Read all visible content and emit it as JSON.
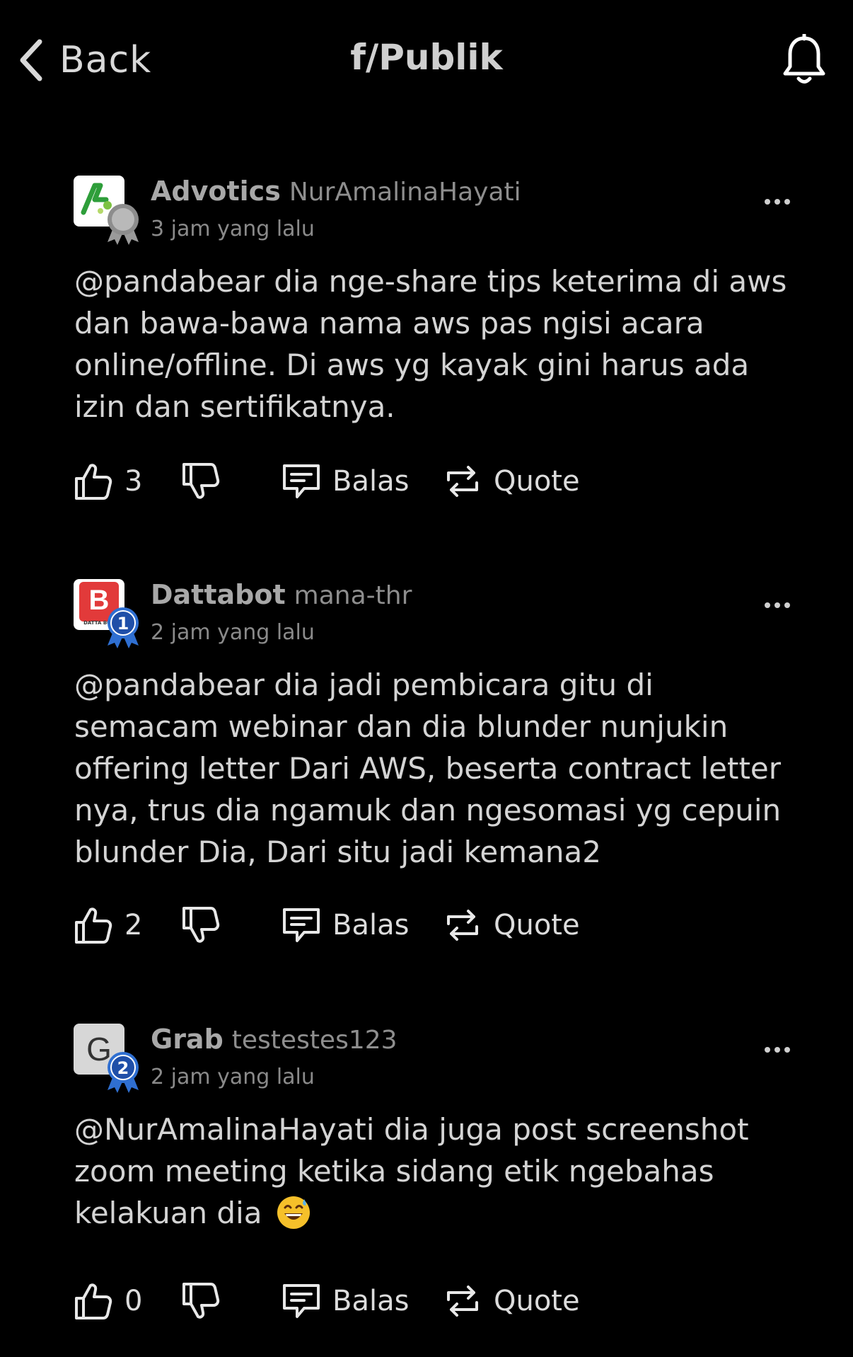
{
  "header": {
    "back_label": "Back",
    "title": "f/Publik"
  },
  "posts": [
    {
      "author": "Advotics",
      "handle": "NurAmalinaHayati",
      "time": "3 jam yang lalu",
      "badge": "silver-medal",
      "text": "@pandabear dia nge-share tips keterima di aws dan bawa-bawa nama aws pas ngisi acara online/offline. Di aws yg kayak gini harus ada izin dan sertifikatnya.",
      "likes": "3",
      "reply_label": "Balas",
      "quote_label": "Quote"
    },
    {
      "author": "Dattabot",
      "handle": "mana-thr",
      "time": "2 jam yang lalu",
      "badge_rank": "1",
      "avatar_letter": "B",
      "avatar_caption": "DATTA BOT",
      "text": "@pandabear dia jadi pembicara gitu di semacam webinar dan dia blunder nunjukin offering letter Dari AWS, beserta contract letter nya, trus dia ngamuk dan ngesomasi yg cepuin blunder Dia, Dari situ jadi kemana2",
      "likes": "2",
      "reply_label": "Balas",
      "quote_label": "Quote"
    },
    {
      "author": "Grab",
      "handle": "testestes123",
      "time": "2 jam yang lalu",
      "badge_rank": "2",
      "avatar_letter": "G",
      "text": "@NurAmalinaHayati dia juga post screenshot zoom meeting ketika sidang etik ngebahas kelakuan dia",
      "emoji": "grinning-face-with-sweat",
      "likes": "0",
      "reply_label": "Balas",
      "quote_label": "Quote"
    }
  ],
  "colors": {
    "background": "#000000",
    "text": "#d4d4d4",
    "muted": "#8a8a8a",
    "badge_blue": "#2f6fd1"
  }
}
